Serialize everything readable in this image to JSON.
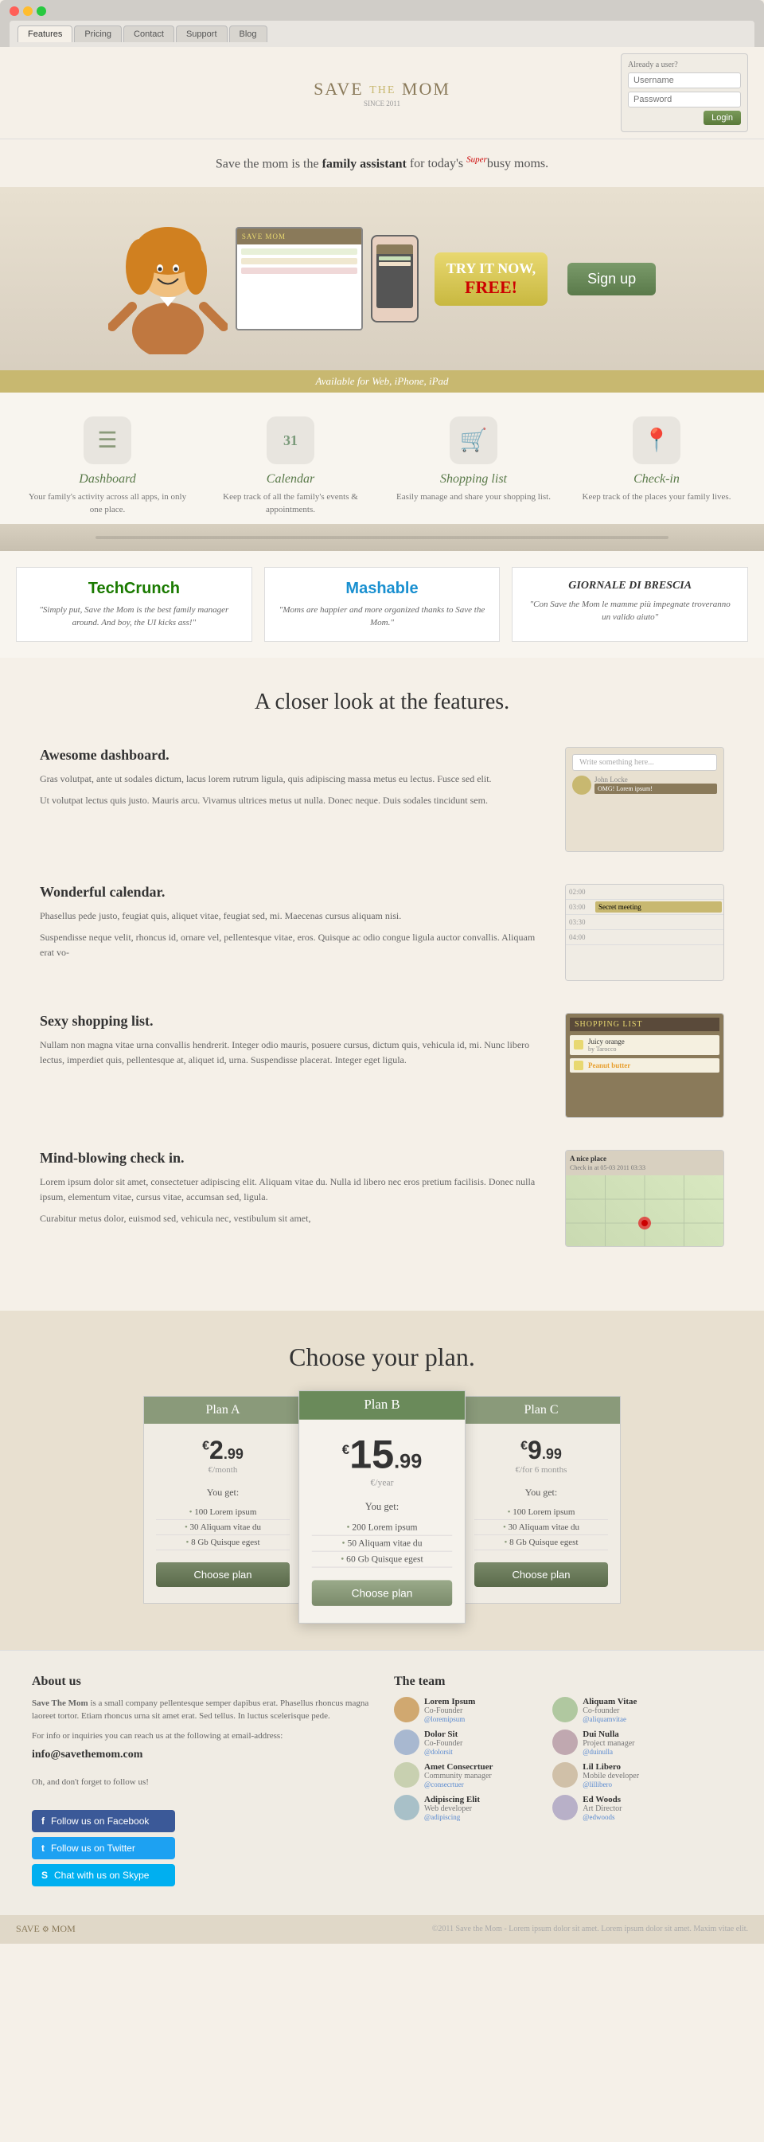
{
  "browser": {
    "buttons": [
      "close",
      "minimize",
      "maximize"
    ],
    "tabs": [
      {
        "label": "Features",
        "active": true
      },
      {
        "label": "Pricing",
        "active": false
      },
      {
        "label": "Contact",
        "active": false
      },
      {
        "label": "Support",
        "active": false
      },
      {
        "label": "Blog",
        "active": false
      }
    ]
  },
  "header": {
    "logo": "SAVE THE MOM",
    "since": "SINCE 2011",
    "already_user": "Already a user?",
    "login_button": "Login",
    "username_placeholder": "Username",
    "password_placeholder": "Password",
    "login_btn": "Login"
  },
  "hero": {
    "tagline_start": "Save the mom is the ",
    "tagline_bold": "family assistant",
    "tagline_super": "Super",
    "tagline_end": " for today's busy moms.",
    "try_free": "TRY IT NOW,",
    "free": "FREE!",
    "signup_btn": "Sign up",
    "available": "Available for Web, iPhone, iPad"
  },
  "features": [
    {
      "icon": "☰",
      "title": "Dashboard",
      "desc": "Your family's activity across all apps, in only one place."
    },
    {
      "icon": "31",
      "title": "Calendar",
      "desc": "Keep track of all the family's events & appointments."
    },
    {
      "icon": "🛒",
      "title": "Shopping list",
      "desc": "Easily manage and share your shopping list."
    },
    {
      "icon": "📍",
      "title": "Check-in",
      "desc": "Keep track of the places your family lives."
    }
  ],
  "press": [
    {
      "logo": "TechCrunch",
      "logo_class": "techcrunch",
      "quote": "\"Simply put, Save the Mom is the best family manager around. And boy, the UI kicks ass!\""
    },
    {
      "logo": "Mashable",
      "logo_class": "mashable",
      "quote": "\"Moms are happier and more organized thanks to Save the Mom.\""
    },
    {
      "logo": "GIORNALE DI BRESCIA",
      "logo_class": "giornale",
      "quote": "\"Con Save the Mom le mamme più impegnate troveranno un valido aiuto\""
    }
  ],
  "closer_look": {
    "heading": "A closer look at the features.",
    "features": [
      {
        "title": "Awesome dashboard.",
        "paragraphs": [
          "Gras volutpat, ante ut sodales dictum, lacus lorem rutrum ligula, quis adipiscing massa metus eu lectus. Fusce sed elit.",
          "Ut volutpat lectus quis justo. Mauris arcu. Vivamus ultrices metus ut nulla. Donec neque. Duis sodales tincidunt sem."
        ]
      },
      {
        "title": "Wonderful calendar.",
        "paragraphs": [
          "Phasellus pede justo, feugiat quis, aliquet vitae, feugiat sed, mi. Maecenas cursus aliquam nisi.",
          "Suspendisse neque velit, rhoncus id, ornare vel, pellentesque vitae, eros. Quisque ac odio congue ligula auctor convallis. Aliquam erat vo-"
        ]
      },
      {
        "title": "Sexy shopping list.",
        "paragraphs": [
          "Nullam non magna vitae urna convallis hendrerit. Integer odio mauris, posuere cursus, dictum quis, vehicula id, mi. Nunc libero lectus, imperdiet quis, pellentesque at, aliquet id, urna. Suspendisse placerat. Integer eget ligula."
        ]
      },
      {
        "title": "Mind-blowing check in.",
        "paragraphs": [
          "Lorem ipsum dolor sit amet, consectetuer adipiscing elit. Aliquam vitae du. Nulla id libero nec eros pretium facilisis. Donec nulla ipsum, elementum vitae, cursus vitae, accumsan sed, ligula.",
          "Curabitur metus dolor, euismod sed, vehicula nec, vestibulum sit amet,"
        ]
      }
    ]
  },
  "shopping_list": {
    "header": "SHOPPING LIST",
    "items": [
      {
        "name": "Juicy orange",
        "sub": "by Tarocco"
      },
      {
        "name": "Peanut butter"
      }
    ]
  },
  "pricing": {
    "heading": "Choose your plan.",
    "plans": [
      {
        "name": "Plan A",
        "price": "2",
        "decimal": ".99",
        "period": "€/month",
        "you_get": "You get:",
        "features": [
          "100 Lorem ipsum",
          "30 Aliquam vitae du",
          "8 Gb Quisque egest"
        ],
        "btn": "Choose plan",
        "featured": false
      },
      {
        "name": "Plan B",
        "price": "15",
        "decimal": ".99",
        "period": "€/year",
        "you_get": "You get:",
        "features": [
          "200 Lorem ipsum",
          "50 Aliquam vitae du",
          "60 Gb Quisque egest"
        ],
        "btn": "Choose plan",
        "featured": true
      },
      {
        "name": "Plan C",
        "price": "9",
        "decimal": ".99",
        "period": "€/for 6 months",
        "you_get": "You get:",
        "features": [
          "100 Lorem ipsum",
          "30 Aliquam vitae du",
          "8 Gb Quisque egest"
        ],
        "btn": "Choose plan",
        "featured": false
      }
    ]
  },
  "footer": {
    "about_heading": "About us",
    "about_text1": " is a small company pellentesque semper dapibus erat. Phasellus rhoncus magna laoreet tortor. Etiam rhoncus urna sit amet erat. Sed tellus. In luctus scelerisque pede.",
    "about_brand": "Save The Mom",
    "contact_text": "For info or inquiries you can reach us at the following at email-address:",
    "email": "info@savethemom.com",
    "social_note": "Oh, and don't forget to follow us!",
    "social_buttons": [
      {
        "label": "Follow us on Facebook",
        "icon": "f",
        "class": "fb-btn"
      },
      {
        "label": "Follow us on Twitter",
        "icon": "t",
        "class": "tw-btn"
      },
      {
        "label": "Chat with us on Skype",
        "icon": "S",
        "class": "sk-btn"
      }
    ],
    "team_heading": "The team",
    "team_members": [
      {
        "name": "Lorem Ipsum",
        "role": "Co-Founder",
        "handle": "@loremipsum"
      },
      {
        "name": "Aliquam Vitae",
        "role": "Co-founder",
        "handle": "@aliquamvitae"
      },
      {
        "name": "Dolor Sit",
        "role": "Co-Founder",
        "handle": "@dolorsit"
      },
      {
        "name": "Dui Nulla",
        "role": "Project manager",
        "handle": "@duinulla"
      },
      {
        "name": "Amet Consecrtuer",
        "role": "Community manager",
        "handle": "@consecrtuer"
      },
      {
        "name": "Lil Libero",
        "role": "Mobile developer",
        "handle": "@lillibero"
      },
      {
        "name": "Adipiscing Elit",
        "role": "Web developer",
        "handle": "@adipiscing"
      },
      {
        "name": "Ed Woods",
        "role": "Art Director",
        "handle": "@edwoods"
      }
    ]
  },
  "bottom_footer": {
    "logo": "SAVE MOM",
    "copy": "©2011 Save the Mom - Lorem ipsum dolor sit amet. Lorem ipsum dolor sit amet. Maxim vitae elit."
  },
  "colors": {
    "green": "#7a9a6a",
    "dark_green": "#5a7a4a",
    "gold": "#c8b870",
    "brown": "#8a7a5a"
  }
}
